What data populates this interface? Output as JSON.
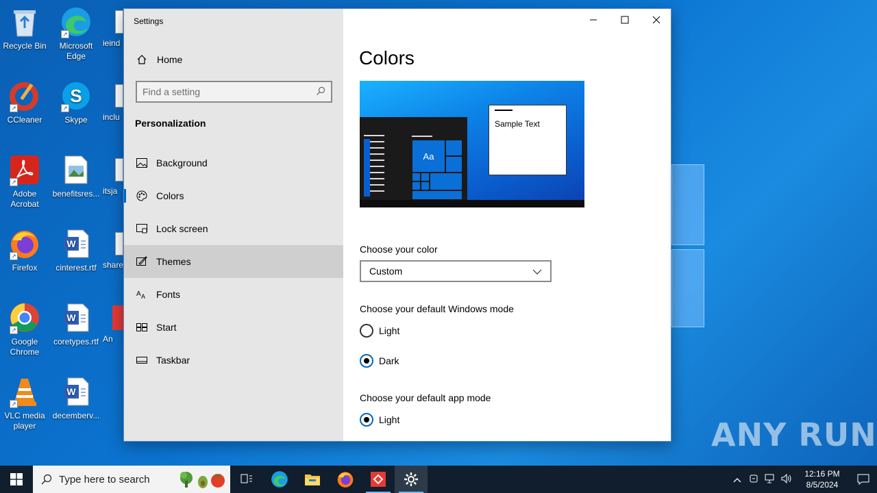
{
  "desktop": {
    "icons": [
      {
        "label": "Recycle Bin",
        "icon": "recycle-bin-icon"
      },
      {
        "label": "Microsoft Edge",
        "icon": "edge-icon"
      },
      {
        "label": "ieind",
        "icon": "file-icon"
      },
      {
        "label": "CCleaner",
        "icon": "ccleaner-icon"
      },
      {
        "label": "Skype",
        "icon": "skype-icon"
      },
      {
        "label": "inclu",
        "icon": "file-icon"
      },
      {
        "label": "Adobe Acrobat",
        "icon": "acrobat-icon"
      },
      {
        "label": "benefitsres...",
        "icon": "image-file-icon"
      },
      {
        "label": "itsja",
        "icon": "file-icon"
      },
      {
        "label": "Firefox",
        "icon": "firefox-icon"
      },
      {
        "label": "cinterest.rtf",
        "icon": "word-file-icon"
      },
      {
        "label": "share",
        "icon": "file-icon"
      },
      {
        "label": "Google Chrome",
        "icon": "chrome-icon"
      },
      {
        "label": "coretypes.rtf",
        "icon": "word-file-icon"
      },
      {
        "label": "An",
        "icon": "anyrun-icon"
      },
      {
        "label": "VLC media player",
        "icon": "vlc-icon"
      },
      {
        "label": "decemberv...",
        "icon": "word-file-icon"
      }
    ]
  },
  "window": {
    "title": "Settings",
    "controls": {
      "minimize": "—",
      "maximize": "☐",
      "close": "✕"
    }
  },
  "sidebar": {
    "home_label": "Home",
    "search_placeholder": "Find a setting",
    "section_title": "Personalization",
    "items": [
      {
        "label": "Background",
        "icon": "picture-icon"
      },
      {
        "label": "Colors",
        "icon": "palette-icon"
      },
      {
        "label": "Lock screen",
        "icon": "lock-screen-icon"
      },
      {
        "label": "Themes",
        "icon": "themes-brush-icon"
      },
      {
        "label": "Fonts",
        "icon": "fonts-icon"
      },
      {
        "label": "Start",
        "icon": "start-grid-icon"
      },
      {
        "label": "Taskbar",
        "icon": "taskbar-icon"
      }
    ],
    "selected": "Colors",
    "hovered": "Themes"
  },
  "content": {
    "page_title": "Colors",
    "preview": {
      "tile_text": "Aa",
      "sample_text": "Sample Text"
    },
    "choose_color_label": "Choose your color",
    "choose_color_value": "Custom",
    "windows_mode_label": "Choose your default Windows mode",
    "windows_mode_options": [
      {
        "label": "Light",
        "selected": false
      },
      {
        "label": "Dark",
        "selected": true
      }
    ],
    "app_mode_label": "Choose your default app mode",
    "app_mode_options": [
      {
        "label": "Light",
        "selected": true
      }
    ]
  },
  "taskbar": {
    "search_placeholder": "Type here to search",
    "apps": [
      "task-view-icon",
      "edge-icon",
      "file-explorer-icon",
      "firefox-icon",
      "anyrun-icon",
      "settings-gear-icon"
    ],
    "active_app": "settings-gear-icon",
    "time": "12:16 PM",
    "date": "8/5/2024"
  },
  "watermark": "ANY RUN"
}
